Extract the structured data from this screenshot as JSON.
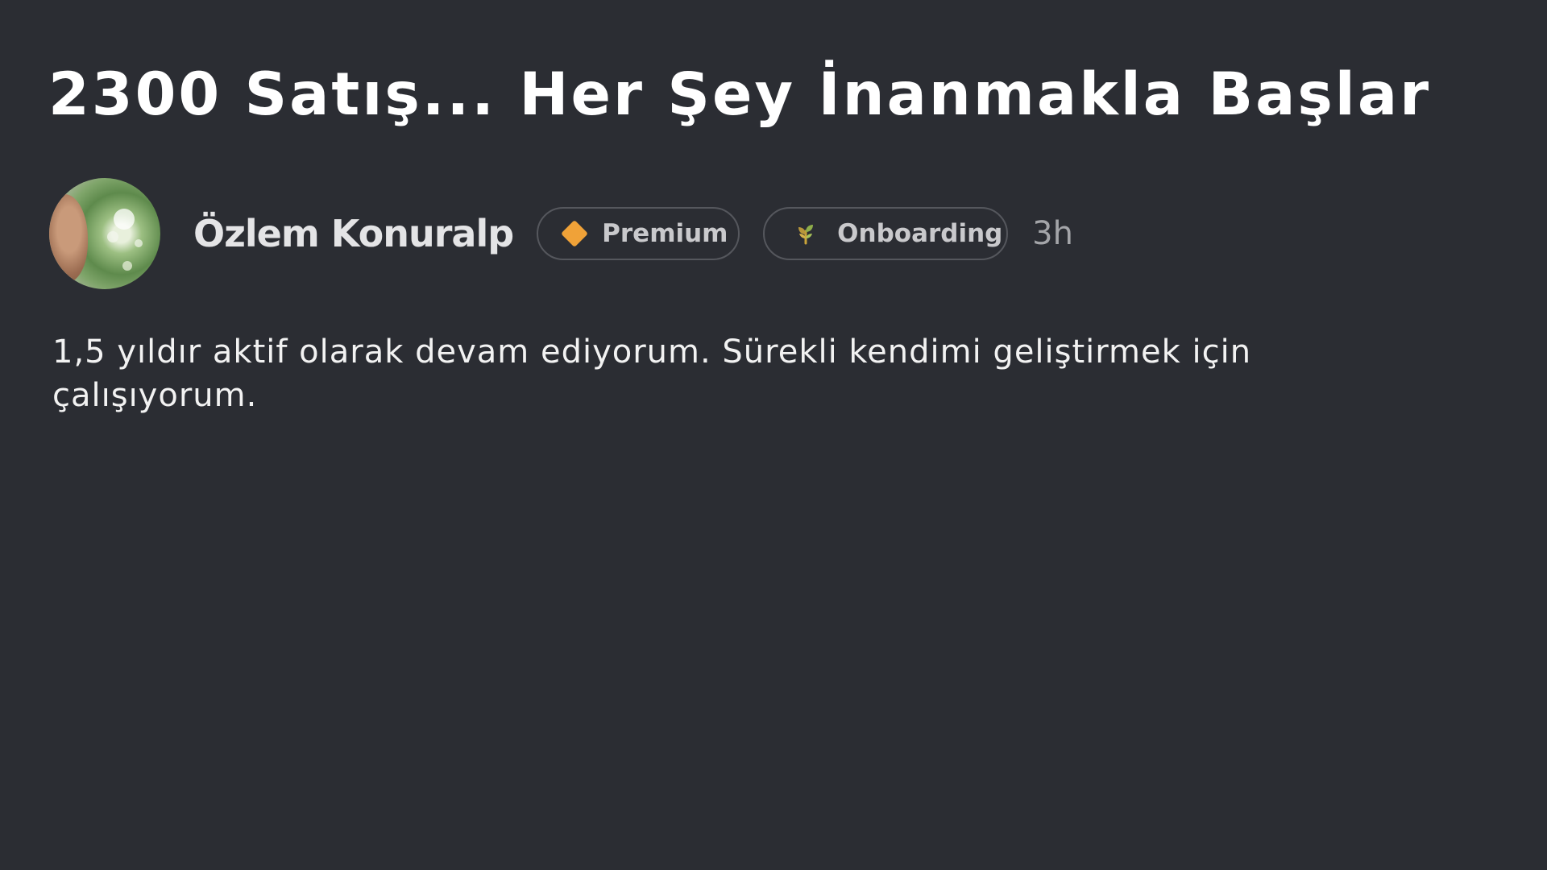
{
  "post": {
    "title": "2300 Satış... Her Şey İnanmakla Başlar",
    "body": "1,5 yıldır aktif olarak devam ediyorum. Sürekli kendimi geliştirmek için çalışıyorum."
  },
  "author": {
    "name": "Özlem Konuralp",
    "posted_ago": "3h",
    "badges": [
      {
        "label": "Premium",
        "icon": "diamond-icon",
        "icon_color": "#f0a238"
      },
      {
        "label": "Onboarding",
        "icon": "sprout-icon",
        "icon_color": "#c9a43a"
      }
    ]
  },
  "colors": {
    "background": "#2b2d33",
    "title_text": "#ffffff",
    "badge_border": "#55575d",
    "muted_text": "#a4a5a9"
  }
}
